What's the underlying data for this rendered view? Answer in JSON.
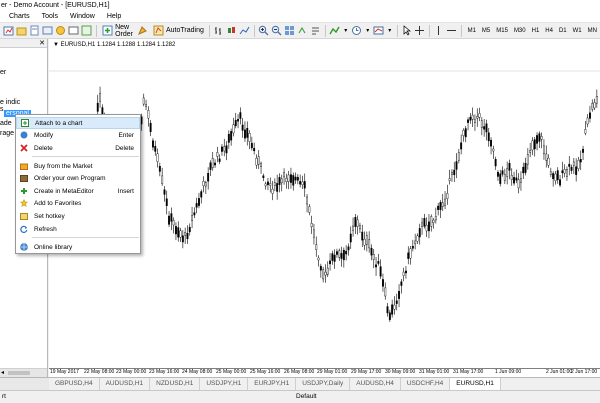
{
  "window": {
    "title": "er - Demo Account - [EURUSD,H1]"
  },
  "menu": {
    "items": [
      "Charts",
      "Tools",
      "Window",
      "Help"
    ]
  },
  "toolbar": {
    "new_order": "New Order",
    "autotrading": "AutoTrading",
    "timeframes": [
      "M1",
      "M5",
      "M15",
      "M30",
      "H1",
      "H4",
      "D1",
      "W1",
      "MN"
    ]
  },
  "navigator": {
    "items": [
      "er",
      "e indic",
      "s",
      "ersonal",
      "ade",
      "rage"
    ]
  },
  "chart": {
    "symbol_line": "EURUSD,H1  1.1284 1.1288 1.1284 1.1282",
    "time_labels": [
      "19 May 2017",
      "22 May 08:00",
      "23 May 00:00",
      "23 May 16:00",
      "24 May 08:00",
      "25 May 00:00",
      "25 May 16:00",
      "26 May 08:00",
      "29 May 01:00",
      "29 May 17:00",
      "30 May 09:00",
      "31 May 01:00",
      "31 May 17:00",
      "1 Jun 09:00",
      "2 Jun 01:00",
      "2 Jun 17:00"
    ]
  },
  "context_menu": {
    "items": [
      {
        "label": "Attach to a chart",
        "key": "",
        "icon": "attach-icon"
      },
      {
        "label": "Modify",
        "key": "Enter",
        "icon": "modify-icon"
      },
      {
        "label": "Delete",
        "key": "Delete",
        "icon": "delete-icon"
      },
      {
        "label": "Buy from the Market",
        "key": "",
        "icon": "market-icon"
      },
      {
        "label": "Order your own Program",
        "key": "",
        "icon": "order-program-icon"
      },
      {
        "label": "Create in MetaEditor",
        "key": "Insert",
        "icon": "create-icon"
      },
      {
        "label": "Add to Favorites",
        "key": "",
        "icon": "star-icon"
      },
      {
        "label": "Set hotkey",
        "key": "",
        "icon": "hotkey-icon"
      },
      {
        "label": "Refresh",
        "key": "",
        "icon": "refresh-icon"
      },
      {
        "label": "Online library",
        "key": "",
        "icon": "globe-icon"
      }
    ]
  },
  "tabs": [
    "GBPUSD,H4",
    "AUDUSD,H1",
    "NZDUSD,H1",
    "USDJPY,H1",
    "EURJPY,H1",
    "USDJPY,Daily",
    "AUDUSD,H4",
    "USDCHF,H4",
    "EURUSD,H1"
  ],
  "active_tab": "EURUSD,H1",
  "status": {
    "left": "rt",
    "profile": "Default"
  },
  "colors": {
    "selection": "#3399ff",
    "hover": "#d9ebfa",
    "candle": "#000000"
  }
}
